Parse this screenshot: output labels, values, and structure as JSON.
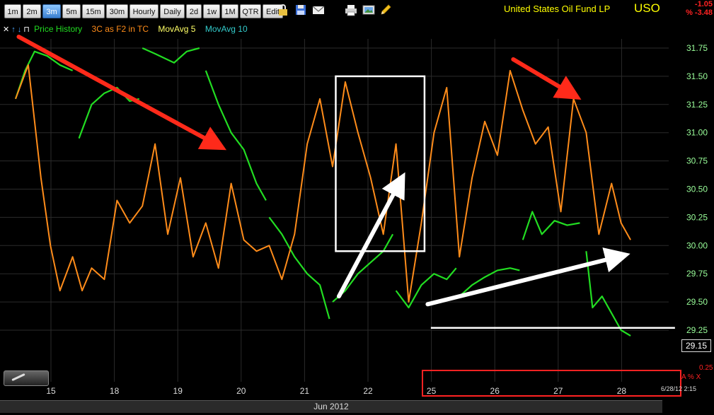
{
  "toolbar": {
    "timeframes": [
      "1m",
      "2m",
      "3m",
      "5m",
      "15m",
      "30m",
      "Hourly",
      "Daily",
      "2d",
      "1w",
      "1M",
      "QTR",
      "Edit"
    ],
    "active_timeframe": "3m",
    "tool_icons": [
      "lock-icon",
      "save-icon",
      "email-icon",
      "print-icon",
      "image-icon",
      "pencil-icon"
    ]
  },
  "symbol": {
    "title": "United States Oil Fund LP",
    "ticker": "USO",
    "change": "-1.05",
    "change_pct": "% -3.48"
  },
  "legend": {
    "arrows": [
      "✕",
      "↑",
      "↓",
      "⊓"
    ],
    "items": [
      {
        "label": "Price History",
        "color": "#22dd22"
      },
      {
        "label": "3C as F2 in TC",
        "color": "#ff8c1a"
      },
      {
        "label": "MovAvg 5",
        "color": "#ffff66"
      },
      {
        "label": "MovAvg 10",
        "color": "#33cccc"
      }
    ]
  },
  "axis": {
    "month": "Jun 2012",
    "last_price": "29.15",
    "timestamp": "6/28/12 2:15",
    "pct_value": "0.25",
    "pct_controls": "A % X"
  },
  "chart_data": {
    "type": "line",
    "x_ticks": [
      "15",
      "18",
      "19",
      "20",
      "21",
      "22",
      "25",
      "26",
      "27",
      "28"
    ],
    "y_ticks": [
      29.25,
      29.5,
      29.75,
      30.0,
      30.25,
      30.5,
      30.75,
      31.0,
      31.25,
      31.5,
      31.75
    ],
    "ylim": [
      29.0,
      31.9
    ],
    "grid": true,
    "colors": {
      "price": "#22dd22",
      "indicator": "#ff8c1a",
      "arrow_red": "#ff2a1a",
      "arrow_white": "#ffffff",
      "grid": "#2b2b2b",
      "axis_text": "#9aff9a",
      "highlight_box": "#ff2222"
    },
    "price_segments": [
      {
        "x": [
          0.0,
          0.15,
          0.3,
          0.5,
          0.7,
          0.9
        ],
        "y": [
          31.3,
          31.55,
          31.72,
          31.68,
          31.6,
          31.55
        ]
      },
      {
        "x": [
          1.0,
          1.2,
          1.4,
          1.6,
          1.8,
          1.95
        ],
        "y": [
          30.95,
          31.25,
          31.35,
          31.4,
          31.28,
          31.3
        ]
      },
      {
        "x": [
          2.0,
          2.2,
          2.5,
          2.7,
          2.9
        ],
        "y": [
          31.75,
          31.7,
          31.62,
          31.72,
          31.75
        ]
      },
      {
        "x": [
          3.0,
          3.2,
          3.4,
          3.6,
          3.8,
          3.95
        ],
        "y": [
          31.55,
          31.25,
          31.0,
          30.85,
          30.55,
          30.4
        ]
      },
      {
        "x": [
          4.0,
          4.2,
          4.4,
          4.6,
          4.8,
          4.95
        ],
        "y": [
          30.25,
          30.1,
          29.9,
          29.75,
          29.65,
          29.35
        ]
      },
      {
        "x": [
          5.0,
          5.2,
          5.4,
          5.6,
          5.8,
          5.95
        ],
        "y": [
          29.5,
          29.6,
          29.75,
          29.85,
          29.95,
          30.1
        ]
      },
      {
        "x": [
          6.0,
          6.2,
          6.4,
          6.6,
          6.8,
          6.95
        ],
        "y": [
          29.6,
          29.45,
          29.65,
          29.75,
          29.7,
          29.8
        ]
      },
      {
        "x": [
          7.0,
          7.2,
          7.4,
          7.6,
          7.8,
          7.95
        ],
        "y": [
          29.55,
          29.65,
          29.72,
          29.78,
          29.8,
          29.78
        ]
      },
      {
        "x": [
          8.0,
          8.15,
          8.3,
          8.5,
          8.7,
          8.9
        ],
        "y": [
          30.05,
          30.3,
          30.1,
          30.22,
          30.18,
          30.2
        ]
      },
      {
        "x": [
          9.0,
          9.1,
          9.25,
          9.4,
          9.55,
          9.7
        ],
        "y": [
          29.95,
          29.45,
          29.55,
          29.4,
          29.25,
          29.2
        ]
      }
    ],
    "indicator_series": {
      "x": [
        0.0,
        0.2,
        0.4,
        0.55,
        0.7,
        0.9,
        1.05,
        1.2,
        1.4,
        1.6,
        1.8,
        2.0,
        2.2,
        2.4,
        2.6,
        2.8,
        3.0,
        3.2,
        3.4,
        3.6,
        3.8,
        4.0,
        4.2,
        4.4,
        4.6,
        4.8,
        5.0,
        5.2,
        5.4,
        5.6,
        5.8,
        6.0,
        6.2,
        6.4,
        6.6,
        6.8,
        7.0,
        7.2,
        7.4,
        7.6,
        7.8,
        8.0,
        8.2,
        8.4,
        8.6,
        8.8,
        9.0,
        9.2,
        9.4,
        9.55,
        9.7
      ],
      "y": [
        31.3,
        31.6,
        30.6,
        30.0,
        29.6,
        29.9,
        29.6,
        29.8,
        29.7,
        30.4,
        30.2,
        30.35,
        30.9,
        30.1,
        30.6,
        29.9,
        30.2,
        29.8,
        30.55,
        30.05,
        29.95,
        30.0,
        29.7,
        30.1,
        30.9,
        31.3,
        30.7,
        31.45,
        31.0,
        30.6,
        30.1,
        30.9,
        29.5,
        30.2,
        31.0,
        31.4,
        29.9,
        30.6,
        31.1,
        30.8,
        31.55,
        31.2,
        30.9,
        31.05,
        30.3,
        31.3,
        31.0,
        30.1,
        30.55,
        30.2,
        30.05
      ]
    },
    "annotations": {
      "red_arrows": [
        {
          "from": [
            0.05,
            31.85
          ],
          "to": [
            3.15,
            30.9
          ]
        },
        {
          "from": [
            7.85,
            31.65
          ],
          "to": [
            8.75,
            31.35
          ]
        }
      ],
      "white_arrows": [
        {
          "from": [
            5.1,
            29.55
          ],
          "to": [
            6.05,
            30.55
          ]
        },
        {
          "from": [
            6.5,
            29.48
          ],
          "to": [
            9.5,
            29.9
          ]
        }
      ],
      "white_box": {
        "x": [
          5.05,
          6.45
        ],
        "y": [
          29.95,
          31.5
        ]
      },
      "support_line": {
        "x": [
          6.55,
          10.4
        ],
        "y": 29.27
      }
    }
  }
}
